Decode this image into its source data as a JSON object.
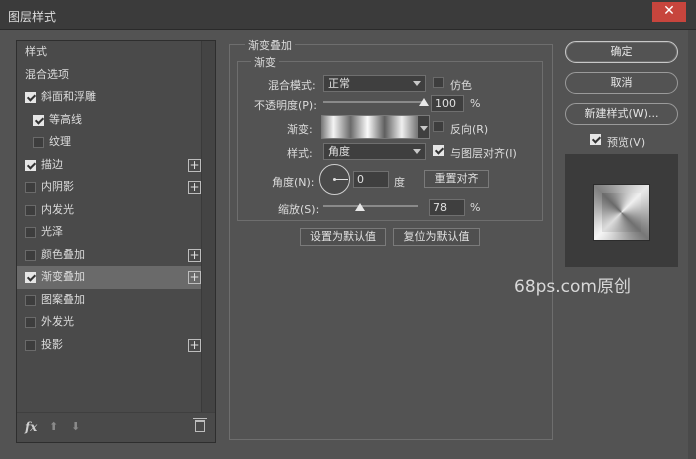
{
  "window": {
    "title": "图层样式",
    "close": "✕"
  },
  "left_panel": {
    "items": [
      {
        "label": "样式",
        "checkbox": false,
        "checked": false,
        "indent": 0,
        "plus": false,
        "selected": false
      },
      {
        "label": "混合选项",
        "checkbox": false,
        "checked": false,
        "indent": 0,
        "plus": false,
        "selected": false
      },
      {
        "label": "斜面和浮雕",
        "checkbox": true,
        "checked": true,
        "indent": 0,
        "plus": false,
        "selected": false
      },
      {
        "label": "等高线",
        "checkbox": true,
        "checked": true,
        "indent": 1,
        "plus": false,
        "selected": false
      },
      {
        "label": "纹理",
        "checkbox": true,
        "checked": false,
        "indent": 1,
        "plus": false,
        "selected": false
      },
      {
        "label": "描边",
        "checkbox": true,
        "checked": true,
        "indent": 0,
        "plus": true,
        "selected": false
      },
      {
        "label": "内阴影",
        "checkbox": true,
        "checked": false,
        "indent": 0,
        "plus": true,
        "selected": false
      },
      {
        "label": "内发光",
        "checkbox": true,
        "checked": false,
        "indent": 0,
        "plus": false,
        "selected": false
      },
      {
        "label": "光泽",
        "checkbox": true,
        "checked": false,
        "indent": 0,
        "plus": false,
        "selected": false
      },
      {
        "label": "颜色叠加",
        "checkbox": true,
        "checked": false,
        "indent": 0,
        "plus": true,
        "selected": false
      },
      {
        "label": "渐变叠加",
        "checkbox": true,
        "checked": true,
        "indent": 0,
        "plus": true,
        "selected": true
      },
      {
        "label": "图案叠加",
        "checkbox": true,
        "checked": false,
        "indent": 0,
        "plus": false,
        "selected": false
      },
      {
        "label": "外发光",
        "checkbox": true,
        "checked": false,
        "indent": 0,
        "plus": false,
        "selected": false
      },
      {
        "label": "投影",
        "checkbox": true,
        "checked": false,
        "indent": 0,
        "plus": true,
        "selected": false
      }
    ],
    "plus_glyph": "+",
    "bottom": {
      "fx": "fx",
      "up": "⬆",
      "down": "⬇"
    }
  },
  "gradient_overlay": {
    "group_title": "渐变叠加",
    "subgroup_title": "渐变",
    "blend_mode_label": "混合模式:",
    "blend_mode_value": "正常",
    "dither_label": "仿色",
    "dither_checked": false,
    "opacity_label": "不透明度(P):",
    "opacity_value": "100",
    "opacity_unit": "%",
    "opacity_fraction": 1.0,
    "gradient_label": "渐变:",
    "reverse_label": "反向(R)",
    "reverse_checked": false,
    "style_label": "样式:",
    "style_value": "角度",
    "align_label": "与图层对齐(I)",
    "align_checked": true,
    "angle_label": "角度(N):",
    "angle_value": "0",
    "angle_unit": "度",
    "reset_align_label": "重置对齐",
    "scale_label": "缩放(S):",
    "scale_value": "78",
    "scale_unit": "%",
    "scale_fraction": 0.39,
    "set_default_label": "设置为默认值",
    "reset_default_label": "复位为默认值"
  },
  "right_panel": {
    "ok_label": "确定",
    "cancel_label": "取消",
    "new_style_label": "新建样式(W)...",
    "preview_label": "预览(V)",
    "preview_checked": true
  },
  "watermark": "68ps.com原创"
}
